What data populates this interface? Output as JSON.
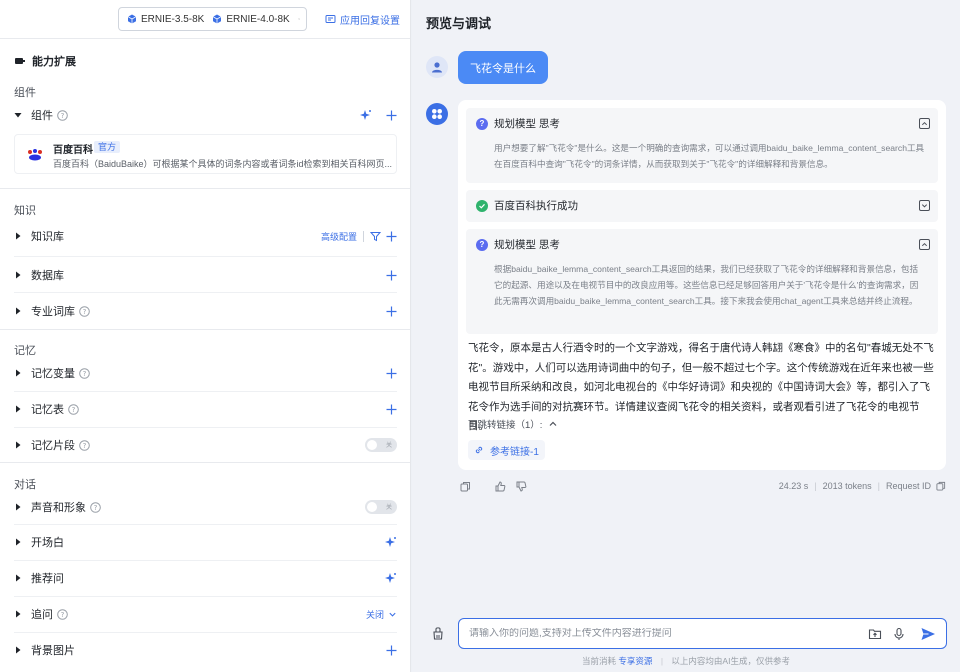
{
  "header": {
    "models": [
      {
        "label": "ERNIE-3.5-8K"
      },
      {
        "label": "ERNIE-4.0-8K"
      }
    ],
    "reply_settings": "应用回复设置"
  },
  "left": {
    "section_title": "能力扩展",
    "groups": {
      "components": "组件",
      "knowledge": "知识",
      "memory": "记忆",
      "dialog": "对话"
    },
    "rows": {
      "components": "组件",
      "knowledge_base": "知识库",
      "advanced_config": "高级配置",
      "database": "数据库",
      "glossary": "专业词库",
      "memory_vars": "记忆变量",
      "memory_table": "记忆表",
      "memory_snippets": "记忆片段",
      "voice_avatar": "声音和形象",
      "opening": "开场白",
      "suggestions": "推荐问",
      "follow_up": "追问",
      "follow_up_state": "关闭",
      "background": "背景图片"
    },
    "toggle_off": "关",
    "plugin": {
      "name": "百度百科",
      "tag": "官方",
      "desc": "百度百科（BaiduBaike）可根据某个具体的词条内容或者词条id检索到相关百科网页..."
    }
  },
  "preview": {
    "title": "预览与调试",
    "user_message": "飞花令是什么",
    "think1": {
      "title": "规划模型 思考",
      "body": "用户想要了解\"飞花令\"是什么。这是一个明确的查询需求，可以通过调用baidu_baike_lemma_content_search工具在百度百科中查询\"飞花令\"的词条详情，从而获取到关于\"飞花令\"的详细解释和背景信息。"
    },
    "tool_result": "百度百科执行成功",
    "think2": {
      "title": "规划模型 思考",
      "body": "根据baidu_baike_lemma_content_search工具返回的结果，我们已经获取了飞花令的详细解释和背景信息，包括它的起源、用途以及在电视节目中的改良应用等。这些信息已经足够回答用户关于'飞花令是什么'的查询需求，因此无需再次调用baidu_baike_lemma_content_search工具。接下来我会使用chat_agent工具来总结并终止流程。"
    },
    "answer": "飞花令，原本是古人行酒令时的一个文字游戏，得名于唐代诗人韩翃《寒食》中的名句\"春城无处不飞花\"。游戏中，人们可以选用诗词曲中的句子，但一般不超过七个字。这个传统游戏在近年来也被一些电视节目所采纳和改良，如河北电视台的《中华好诗词》和央视的《中国诗词大会》等，都引入了飞花令作为选手间的对抗赛环节。详情建议查阅飞花令的相关资料，或者观看引进了飞花令的电视节目。",
    "jump_links": "可跳转链接（1）:",
    "ref_link": "参考链接-1",
    "stats": {
      "time": "24.23 s",
      "tokens": "2013 tokens",
      "request_id": "Request ID"
    },
    "input_placeholder": "请输入你的问题,支持对上传文件内容进行提问",
    "disclaimer_prefix": "当前消耗",
    "disclaimer_link": "专享资源",
    "disclaimer_suffix": "以上内容均由AI生成，仅供参考"
  },
  "colors": {
    "accent": "#3b6fe5",
    "user_bubble": "#4b8af5",
    "success": "#2fb36d"
  }
}
